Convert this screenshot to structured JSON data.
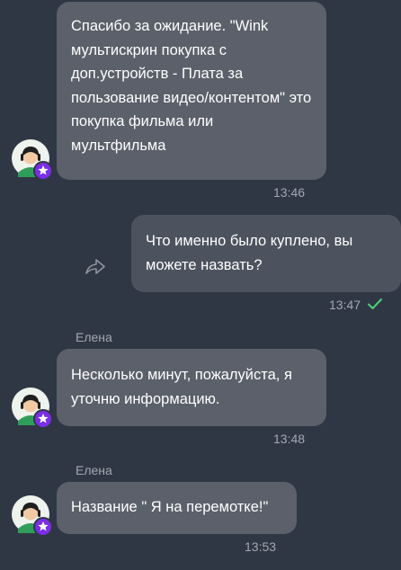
{
  "chat": {
    "messages": [
      {
        "text": "Спасибо за ожидание. \"Wink мультискрин покупка с доп.устройств - Плата за пользование видео/контентом\" это покупка фильма или мультфильма",
        "time": "13:46"
      },
      {
        "text": "Что именно было куплено, вы можете назвать?",
        "time": "13:47",
        "status": "read-check-icon"
      },
      {
        "sender": "Елена",
        "text": "Несколько минут, пожалуйста, я уточню информацию.",
        "time": "13:48"
      },
      {
        "sender": "Елена",
        "text": "Название \" Я на перемотке!\"",
        "time": "13:53"
      }
    ]
  },
  "colors": {
    "background": "#303744",
    "incoming_bubble": "#5c606a",
    "outgoing_bubble": "#4d535e",
    "check": "#4ad17a",
    "star_badge": "#7a2ee6"
  },
  "icons": {
    "forward": "forward-arrow-icon",
    "avatar": "operator-avatar-icon",
    "badge": "star-badge-icon"
  }
}
